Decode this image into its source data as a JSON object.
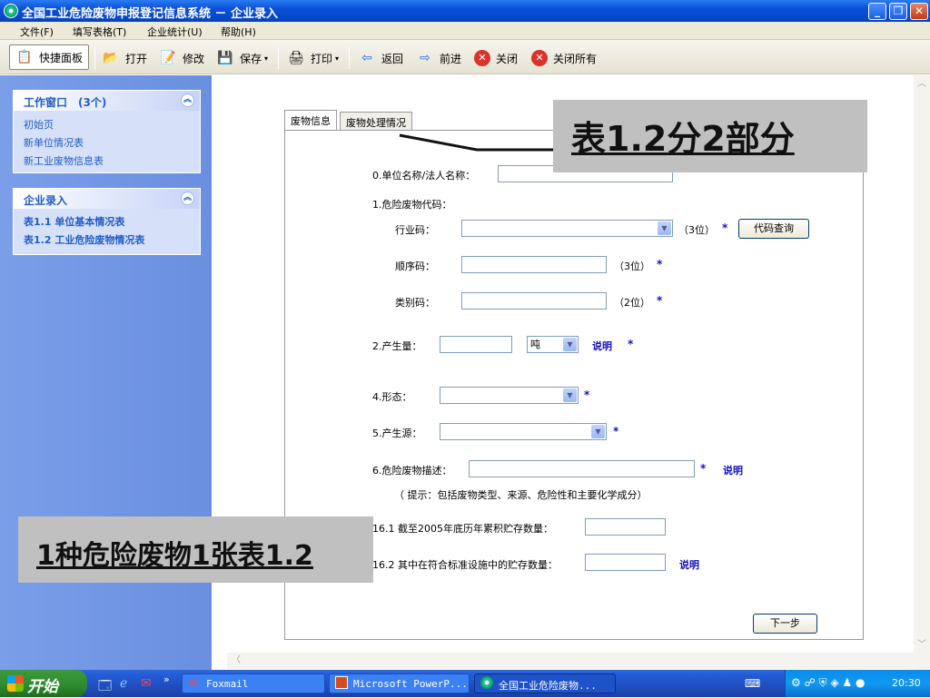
{
  "window": {
    "title": "全国工业危险废物申报登记信息系统 － 企业录入"
  },
  "menu": [
    "文件(F)",
    "填写表格(T)",
    "企业统计(U)",
    "帮助(H)"
  ],
  "toolbar": {
    "quick": "快捷面板",
    "open": "打开",
    "edit": "修改",
    "save": "保存",
    "print": "打印",
    "back": "返回",
    "forward": "前进",
    "close": "关闭",
    "close_all": "关闭所有"
  },
  "sidebar": {
    "work": {
      "title": "工作窗口　(3个)",
      "items": [
        "初始页",
        "新单位情况表",
        "新工业废物信息表"
      ]
    },
    "entry": {
      "title": "企业录入",
      "items": [
        "表1.1 单位基本情况表",
        "表1.2 工业危险废物情况表"
      ]
    }
  },
  "tabs": [
    "废物信息",
    "废物处理情况"
  ],
  "form": {
    "f0": "0.单位名称/法人名称：",
    "f1": "1.危险废物代码：",
    "industry": "行业码：",
    "industry_hint": "（3位）",
    "query_btn": "代码查询",
    "seq": "顺序码：",
    "seq_hint": "（3位）",
    "cat": "类别码：",
    "cat_hint": "（2位）",
    "f2": "2.产生量：",
    "unit": "吨",
    "explain": "说明",
    "f4": "4.形态：",
    "f5": "5.产生源：",
    "f6": "6.危险废物描述：",
    "f6_tip": "（ 提示：包括废物类型、来源、危险性和主要化学成分）",
    "f161": "16.1 截至2005年底历年累积贮存数量：",
    "f162": "16.2 其中在符合标准设施中的贮存数量：",
    "star": "*",
    "next": "下一步"
  },
  "callouts": {
    "top": "表1.2分2部分",
    "left": "1种危险废物1张表1.2"
  },
  "taskbar": {
    "start": "开始",
    "tasks": [
      "Foxmail",
      "Microsoft PowerP...",
      "全国工业危险废物..."
    ],
    "clock": "20:30"
  }
}
